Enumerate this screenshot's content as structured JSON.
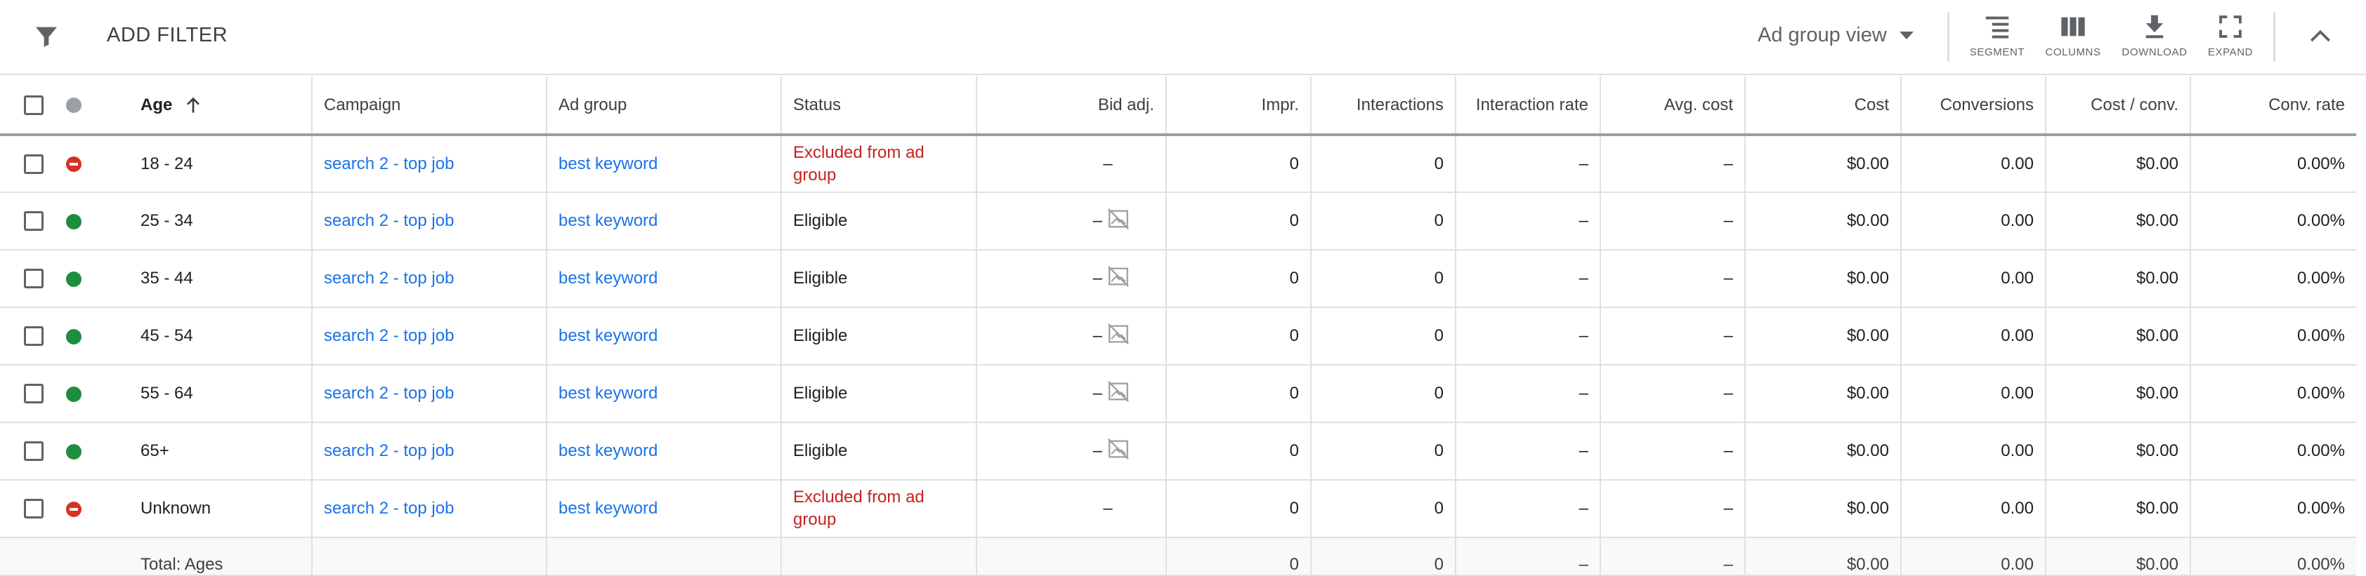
{
  "toolbar": {
    "add_filter": "ADD FILTER",
    "view_select": "Ad group view",
    "tools": [
      {
        "label": "SEGMENT",
        "icon": "segment-icon"
      },
      {
        "label": "COLUMNS",
        "icon": "columns-icon"
      },
      {
        "label": "DOWNLOAD",
        "icon": "download-icon"
      },
      {
        "label": "EXPAND",
        "icon": "expand-icon"
      }
    ]
  },
  "table": {
    "headers": {
      "age": "Age",
      "campaign": "Campaign",
      "ad_group": "Ad group",
      "status": "Status",
      "bid_adj": "Bid adj.",
      "impr": "Impr.",
      "interactions": "Interactions",
      "interaction_rate": "Interaction rate",
      "avg_cost": "Avg. cost",
      "cost": "Cost",
      "conversions": "Conversions",
      "cost_per_conv": "Cost / conv.",
      "conv_rate": "Conv. rate"
    },
    "rows": [
      {
        "status_dot": "excluded",
        "age": "18 - 24",
        "campaign": "search 2 - top job",
        "ad_group": "best keyword",
        "status": "Excluded from ad group",
        "bid_adj": "–",
        "impr": "0",
        "interactions": "0",
        "interaction_rate": "–",
        "avg_cost": "–",
        "cost": "$0.00",
        "conversions": "0.00",
        "cost_per_conv": "$0.00",
        "conv_rate": "0.00%"
      },
      {
        "status_dot": "eligible",
        "age": "25 - 34",
        "campaign": "search 2 - top job",
        "ad_group": "best keyword",
        "status": "Eligible",
        "bid_adj": "–",
        "impr": "0",
        "interactions": "0",
        "interaction_rate": "–",
        "avg_cost": "–",
        "cost": "$0.00",
        "conversions": "0.00",
        "cost_per_conv": "$0.00",
        "conv_rate": "0.00%"
      },
      {
        "status_dot": "eligible",
        "age": "35 - 44",
        "campaign": "search 2 - top job",
        "ad_group": "best keyword",
        "status": "Eligible",
        "bid_adj": "–",
        "impr": "0",
        "interactions": "0",
        "interaction_rate": "–",
        "avg_cost": "–",
        "cost": "$0.00",
        "conversions": "0.00",
        "cost_per_conv": "$0.00",
        "conv_rate": "0.00%"
      },
      {
        "status_dot": "eligible",
        "age": "45 - 54",
        "campaign": "search 2 - top job",
        "ad_group": "best keyword",
        "status": "Eligible",
        "bid_adj": "–",
        "impr": "0",
        "interactions": "0",
        "interaction_rate": "–",
        "avg_cost": "–",
        "cost": "$0.00",
        "conversions": "0.00",
        "cost_per_conv": "$0.00",
        "conv_rate": "0.00%"
      },
      {
        "status_dot": "eligible",
        "age": "55 - 64",
        "campaign": "search 2 - top job",
        "ad_group": "best keyword",
        "status": "Eligible",
        "bid_adj": "–",
        "impr": "0",
        "interactions": "0",
        "interaction_rate": "–",
        "avg_cost": "–",
        "cost": "$0.00",
        "conversions": "0.00",
        "cost_per_conv": "$0.00",
        "conv_rate": "0.00%"
      },
      {
        "status_dot": "eligible",
        "age": "65+",
        "campaign": "search 2 - top job",
        "ad_group": "best keyword",
        "status": "Eligible",
        "bid_adj": "–",
        "impr": "0",
        "interactions": "0",
        "interaction_rate": "–",
        "avg_cost": "–",
        "cost": "$0.00",
        "conversions": "0.00",
        "cost_per_conv": "$0.00",
        "conv_rate": "0.00%"
      },
      {
        "status_dot": "excluded",
        "age": "Unknown",
        "campaign": "search 2 - top job",
        "ad_group": "best keyword",
        "status": "Excluded from ad group",
        "bid_adj": "–",
        "impr": "0",
        "interactions": "0",
        "interaction_rate": "–",
        "avg_cost": "–",
        "cost": "$0.00",
        "conversions": "0.00",
        "cost_per_conv": "$0.00",
        "conv_rate": "0.00%"
      }
    ],
    "total": {
      "label": "Total: Ages",
      "impr": "0",
      "interactions": "0",
      "interaction_rate": "–",
      "avg_cost": "–",
      "cost": "$0.00",
      "conversions": "0.00",
      "cost_per_conv": "$0.00",
      "conv_rate": "0.00%"
    }
  },
  "colors": {
    "link": "#1a73e8",
    "excluded_text": "#c5221f",
    "eligible_dot": "#1e8e3e",
    "excluded_dot": "#d93025"
  }
}
